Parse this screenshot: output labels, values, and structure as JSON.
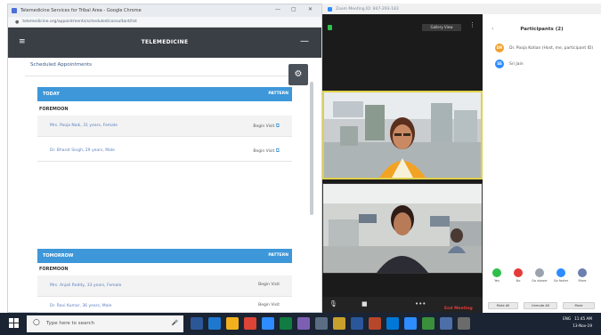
{
  "browser": {
    "window_title": "Telemedicine Services for Tribal Area - Google Chrome",
    "url": "telemedicine.org/appointments/scheduled/consultant/list",
    "app_title": "TELEMEDICINE",
    "panel_label": "Scheduled Appointments",
    "sections": [
      {
        "label": "TODAY",
        "right_label": "PATTERN",
        "sub_label": "FOREMOON",
        "rows": [
          {
            "name": "Mrs. Pooja Naik, 31 years, Female",
            "action": "Begin Visit"
          },
          {
            "name": "Dr. Bharat Singh, 29 years, Male",
            "action": "Begin Visit"
          }
        ]
      },
      {
        "label": "TOMORROW",
        "right_label": "PATTERN",
        "sub_label": "FOREMOON",
        "rows": [
          {
            "name": "Mrs. Anjali Reddy, 33 years, Female",
            "action": "Begin Visit"
          },
          {
            "name": "Dr. Ravi Kumar, 36 years, Male",
            "action": "Begin Visit"
          }
        ]
      }
    ]
  },
  "zoom": {
    "window_title": "Zoom Meeting ID: 847-293-183",
    "gallery_view_label": "Gallery View",
    "controls": [
      {
        "icon": "mic-icon",
        "label": "Unmute"
      },
      {
        "icon": "video-icon",
        "label": "Start Video"
      },
      {
        "icon": "more-icon",
        "label": "More"
      }
    ],
    "end_meeting": "End Meeting",
    "participants": {
      "header": "Participants (2)",
      "list": [
        {
          "initials": "DR",
          "name": "Dr. Pooja Kotian (Host, me, participant ID)",
          "color": "#f0a030"
        },
        {
          "initials": "SS",
          "name": "Sri Jain",
          "color": "#2d8cff"
        }
      ],
      "actions": [
        {
          "label": "Yes",
          "color": "#2fbf4a"
        },
        {
          "label": "No",
          "color": "#e63a3a"
        },
        {
          "label": "Go slower",
          "color": "#9aa3ad"
        },
        {
          "label": "Go faster",
          "color": "#2d8cff"
        },
        {
          "label": "More",
          "color": "#6b7fb0"
        }
      ],
      "buttons": [
        "Mute All",
        "Unmute All",
        "More"
      ]
    }
  },
  "taskbar": {
    "search_placeholder": "Type here to search",
    "time": "11:45 AM",
    "date": "13-Nov-19",
    "lang": "ENG"
  },
  "colors": {
    "primary_blue": "#3d97d9",
    "app_header": "#3a3f45",
    "zoom_end": "#e63a3a",
    "speaker_border": "#e0d04a",
    "taskbar": "#1a2433"
  }
}
